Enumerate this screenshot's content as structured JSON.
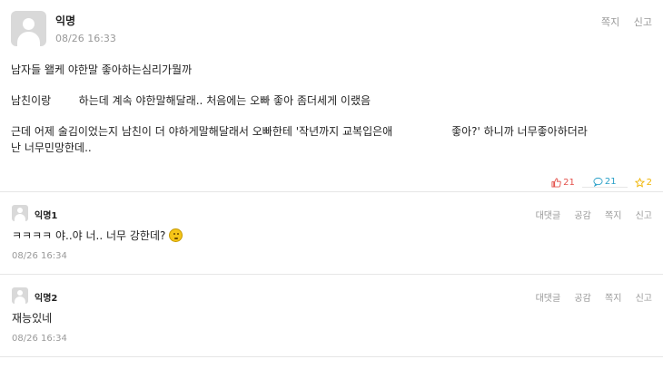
{
  "post": {
    "author": "익명",
    "datetime": "08/26 16:33",
    "actions": [
      "쪽지",
      "신고"
    ],
    "lines": [
      "남자들 왤케 야한말 좋아하는심리가뭘까",
      "남친이랑        하는데 계속 야한말해달래.. 처음에는 오빠 좋아 좀더세게 이랬음",
      "근데 어제 술김이었는지 남친이 더 야하게말해달래서 오빠한테 '작년까지 교복입은애                 좋아?' 하니까 너무좋아하더라",
      "난 너무민망한데.."
    ],
    "stats": {
      "likes": "21",
      "comments": "21",
      "scraps": "2"
    }
  },
  "comments": [
    {
      "author": "익명1",
      "actions": [
        "대댓글",
        "공감",
        "쪽지",
        "신고"
      ],
      "text": "ㅋㅋㅋㅋ 야..야 너.. 너무 강한데?",
      "time": "08/26 16:34"
    },
    {
      "author": "익명2",
      "actions": [
        "대댓글",
        "공감",
        "쪽지",
        "신고"
      ],
      "text": "재능있네",
      "time": "08/26 16:34"
    }
  ],
  "colors": {
    "like": "#e4524c",
    "comment": "#2aa0c8",
    "scrap": "#f0b400",
    "muted": "#999999"
  },
  "icons": {
    "like": "thumbs-up-icon",
    "comment": "speech-bubble-icon",
    "scrap": "star-icon",
    "emoji": "grimacing-face-icon"
  }
}
